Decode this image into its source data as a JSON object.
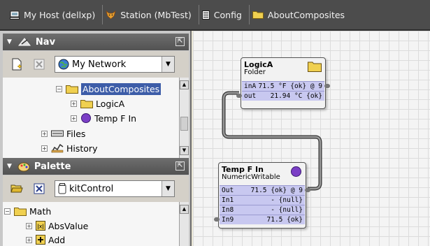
{
  "breadcrumb": {
    "items": [
      {
        "label": "My Host (dellxp)",
        "icon": "host-icon"
      },
      {
        "label": "Station (MbTest)",
        "icon": "station-fox-icon"
      },
      {
        "label": "Config",
        "icon": "config-list-icon"
      },
      {
        "label": "AboutComposites",
        "icon": "folder-icon"
      }
    ]
  },
  "nav": {
    "title": "Nav",
    "combo_value": "My Network",
    "tree": [
      {
        "label": "AboutComposites",
        "selected": true
      },
      {
        "label": "LogicA"
      },
      {
        "label": "Temp F In"
      },
      {
        "label": "Files"
      },
      {
        "label": "History"
      }
    ]
  },
  "palette": {
    "title": "Palette",
    "combo_value": "kitControl",
    "tree": [
      {
        "label": "Math"
      },
      {
        "label": "AbsValue"
      },
      {
        "label": "Add"
      }
    ]
  },
  "wiresheet": {
    "logicA": {
      "name": "LogicA",
      "type": "Folder",
      "slots": [
        {
          "name": "inA",
          "value": "71.5 °F {ok} @ 9"
        },
        {
          "name": "out",
          "value": "21.94 °C {ok}"
        }
      ]
    },
    "tempF": {
      "name": "Temp F In",
      "type": "NumericWritable",
      "slots": [
        {
          "name": "Out",
          "value": "71.5 {ok} @ 9"
        },
        {
          "name": "In1",
          "value": "- {null}"
        },
        {
          "name": "In8",
          "value": "- {null}"
        },
        {
          "name": "In9",
          "value": "71.5 {ok}"
        }
      ]
    }
  },
  "colors": {
    "slot_fill": "#c8c8f0",
    "selection": "#3d5da8",
    "header_bar": "#4c4c4c",
    "writable_dot": "#7b3fc6",
    "folder_yellow": "#f0d050"
  }
}
